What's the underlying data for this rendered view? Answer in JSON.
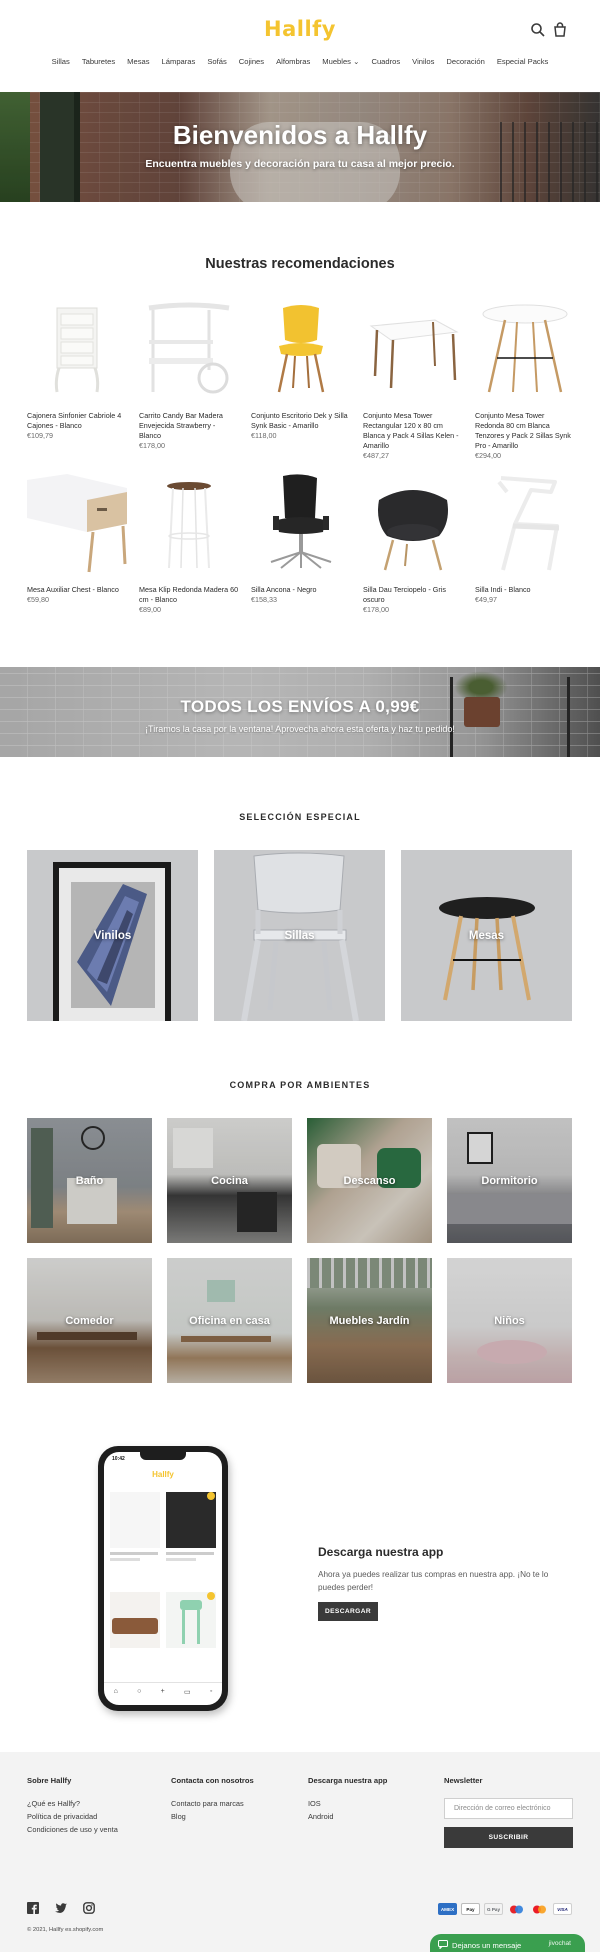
{
  "header": {
    "logo": "Hallfy",
    "nav": [
      "Sillas",
      "Taburetes",
      "Mesas",
      "Lámparas",
      "Sofás",
      "Cojines",
      "Alfombras",
      "Muebles",
      "Cuadros",
      "Vinilos",
      "Decoración",
      "Especial Packs"
    ],
    "nav_dropdown_marker": "⌄"
  },
  "hero": {
    "title": "Bienvenidos a Hallfy",
    "subtitle": "Encuentra muebles y decoración para tu casa al mejor precio."
  },
  "recommendations": {
    "title": "Nuestras recomendaciones",
    "products": [
      {
        "name": "Cajonera Sinfonier Cabriole 4 Cajones - Blanco",
        "price": "€109,79"
      },
      {
        "name": "Carrito Candy Bar Madera Envejecida Strawberry - Blanco",
        "price": "€178,00"
      },
      {
        "name": "Conjunto Escritorio Dek y Silla Synk Basic - Amarillo",
        "price": "€118,00"
      },
      {
        "name": "Conjunto Mesa Tower Rectangular 120 x 80 cm Blanca y Pack 4 Sillas Kelen - Amarillo",
        "price": "€487,27"
      },
      {
        "name": "Conjunto Mesa Tower Redonda 80 cm Blanca Tenzores y Pack 2 Sillas Synk Pro - Amarillo",
        "price": "€294,00"
      },
      {
        "name": "Mesa Auxiliar Chest - Blanco",
        "price": "€59,80"
      },
      {
        "name": "Mesa Klip Redonda Madera 60 cm - Blanco",
        "price": "€89,00"
      },
      {
        "name": "Silla Ancona - Negro",
        "price": "€158,33"
      },
      {
        "name": "Silla Dau Terciopelo - Gris oscuro",
        "price": "€178,00"
      },
      {
        "name": "Silla Indi - Blanco",
        "price": "€49,97"
      }
    ]
  },
  "shipping_banner": {
    "title": "TODOS LOS ENVÍOS A 0,99€",
    "subtitle": "¡Tiramos la casa por la ventana! Aprovecha ahora esta oferta y haz tu pedido!"
  },
  "special": {
    "heading": "SELECCIÓN ESPECIAL",
    "items": [
      "Vinilos",
      "Sillas",
      "Mesas"
    ]
  },
  "rooms": {
    "heading": "COMPRA POR AMBIENTES",
    "items": [
      "Baño",
      "Cocina",
      "Descanso",
      "Dormitorio",
      "Comedor",
      "Oficina en casa",
      "Muebles Jardín",
      "Niños"
    ]
  },
  "app": {
    "phone_time": "10:42",
    "phone_logo": "Hallfy",
    "title": "Descarga nuestra app",
    "text": "Ahora ya puedes realizar tus compras en nuestra app. ¡No te lo puedes perder!",
    "button": "DESCARGAR"
  },
  "footer": {
    "col1": {
      "heading": "Sobre Hallfy",
      "links": [
        "¿Qué es Hallfy?",
        "Política de privacidad",
        "Condiciones de uso y venta"
      ]
    },
    "col2": {
      "heading": "Contacta con nosotros",
      "links": [
        "Contacto para marcas",
        "Blog"
      ]
    },
    "col3": {
      "heading": "Descarga nuestra app",
      "links": [
        "IOS",
        "Android"
      ]
    },
    "newsletter": {
      "heading": "Newsletter",
      "placeholder": "Dirección de correo electrónico",
      "button": "SUSCRIBIR"
    },
    "copyright": "© 2021, Hallfy es.shopify.com",
    "payments": [
      "AMEX",
      "Pay",
      "G Pay",
      "",
      "",
      "VISA"
    ]
  },
  "chat": {
    "label": "Dejanos un mensaje",
    "brand": "jivochat"
  }
}
